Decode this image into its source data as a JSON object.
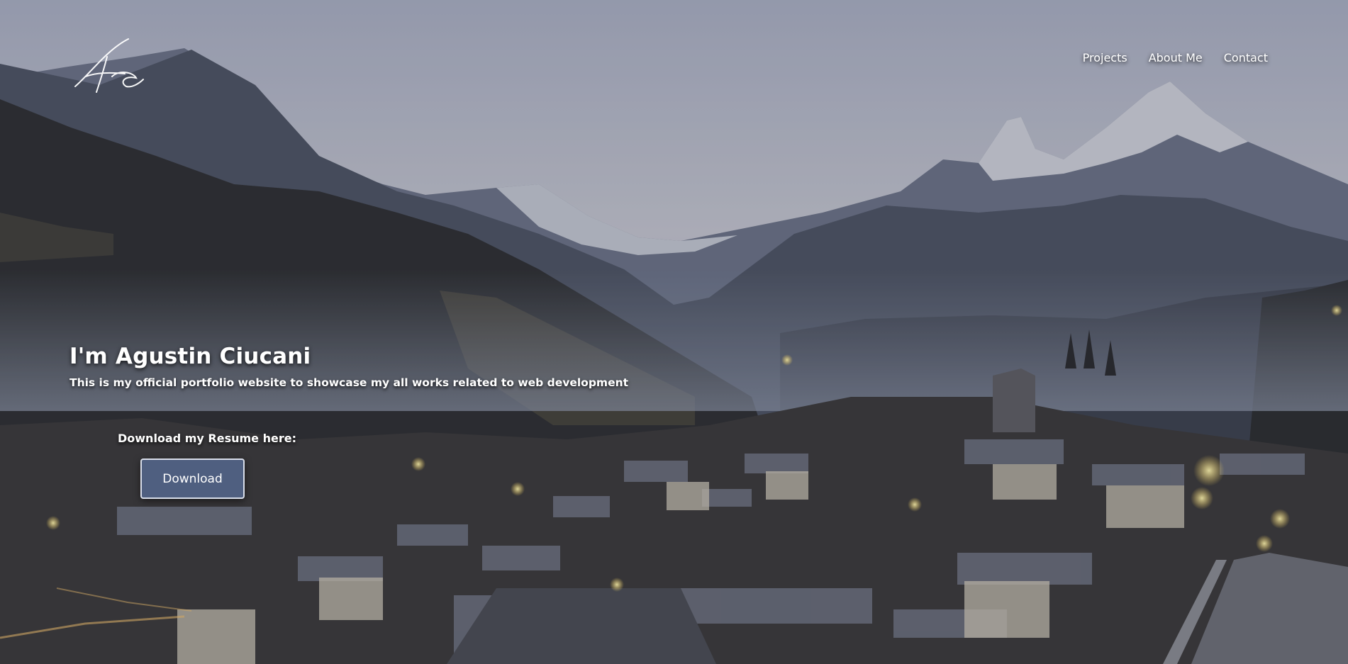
{
  "logo": {
    "text": "Ac"
  },
  "nav": {
    "items": [
      {
        "label": "Projects"
      },
      {
        "label": "About Me"
      },
      {
        "label": "Contact"
      }
    ]
  },
  "hero": {
    "title": "I'm Agustin Ciucani",
    "subtitle": "This is my official portfolio website to showcase my all works related to web development",
    "resume_label": "Download my Resume here:",
    "download_label": "Download"
  },
  "colors": {
    "button_bg": "#4f5f80",
    "button_border": "#d9deea",
    "text": "#ffffff"
  }
}
